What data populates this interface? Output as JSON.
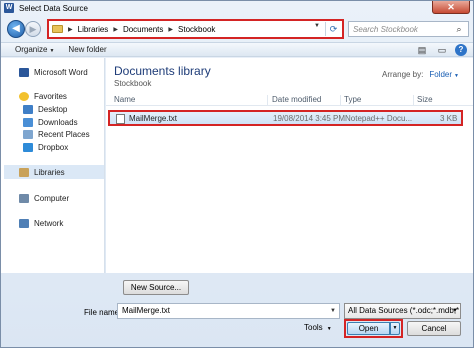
{
  "window": {
    "title": "Select Data Source",
    "close_label": "✕"
  },
  "address_bar": {
    "breadcrumbs": [
      "Libraries",
      "Documents",
      "Stockbook"
    ],
    "search_placeholder": "Search Stockbook"
  },
  "toolbar": {
    "organize": "Organize",
    "new_folder": "New folder"
  },
  "nav_pane": {
    "microsoft_word": "Microsoft Word",
    "favorites": "Favorites",
    "desktop": "Desktop",
    "downloads": "Downloads",
    "recent_places": "Recent Places",
    "dropbox": "Dropbox",
    "libraries": "Libraries",
    "computer": "Computer",
    "network": "Network"
  },
  "content": {
    "library_title": "Documents library",
    "library_subtitle": "Stockbook",
    "arrange_label": "Arrange by:",
    "arrange_value": "Folder",
    "columns": {
      "name": "Name",
      "date": "Date modified",
      "type": "Type",
      "size": "Size"
    },
    "files": [
      {
        "name": "MailMerge.txt",
        "date": "19/08/2014 3:45 PM",
        "type": "Notepad++ Docu...",
        "size": "3 KB"
      }
    ]
  },
  "footer": {
    "new_source": "New Source...",
    "file_name_label": "File name:",
    "file_name_value": "MailMerge.txt",
    "file_type": "All Data Sources (*.odc;*.mdb;*",
    "tools": "Tools",
    "open": "Open",
    "cancel": "Cancel"
  }
}
